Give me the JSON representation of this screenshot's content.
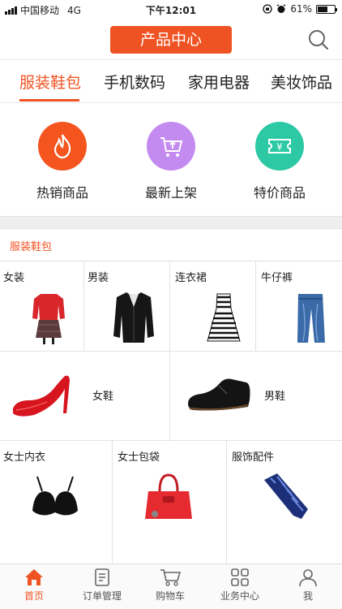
{
  "status_bar": {
    "carrier": "中国移动",
    "network": "4G",
    "time": "下午12:01",
    "battery": "61%",
    "battery_level": 0.61
  },
  "header": {
    "title": "产品中心"
  },
  "tabs": [
    {
      "label": "服装鞋包"
    },
    {
      "label": "手机数码"
    },
    {
      "label": "家用电器"
    },
    {
      "label": "美妆饰品"
    }
  ],
  "shortcuts": [
    {
      "label": "热销商品",
      "icon": "flame-icon",
      "color": "#f4551f"
    },
    {
      "label": "最新上架",
      "icon": "cart-upload-icon",
      "color": "#c38af0"
    },
    {
      "label": "特价商品",
      "icon": "ticket-yen-icon",
      "color": "#2cc9a4"
    }
  ],
  "section": {
    "title": "服装鞋包"
  },
  "categories": {
    "row1": [
      "女装",
      "男装",
      "连衣裙",
      "牛仔裤"
    ],
    "row2": [
      "女鞋",
      "男鞋"
    ],
    "row3": [
      "女士内衣",
      "女士包袋",
      "服饰配件"
    ]
  },
  "bottom_nav": [
    {
      "label": "首页",
      "icon": "home-icon"
    },
    {
      "label": "订单管理",
      "icon": "order-icon"
    },
    {
      "label": "购物车",
      "icon": "cart-icon"
    },
    {
      "label": "业务中心",
      "icon": "grid-icon"
    },
    {
      "label": "我",
      "icon": "user-icon"
    }
  ],
  "colors": {
    "accent": "#f05323"
  }
}
